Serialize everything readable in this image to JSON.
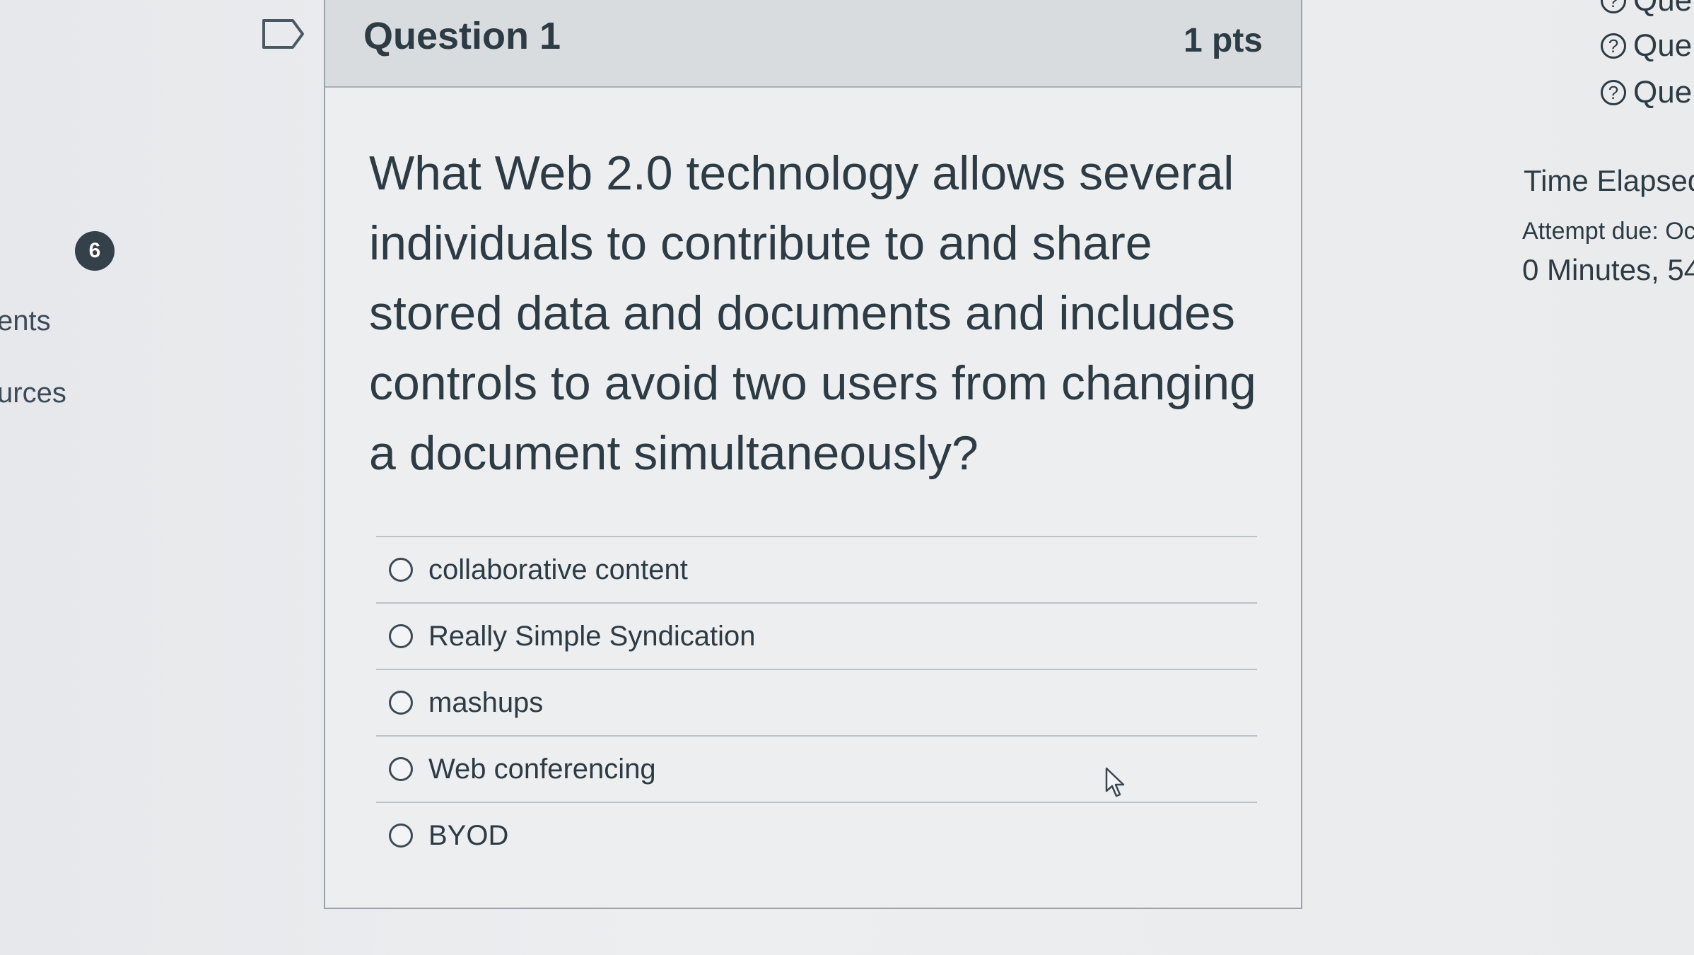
{
  "left_nav": {
    "badge_count": "6",
    "items": [
      {
        "label": "ents"
      },
      {
        "label": "urces"
      }
    ]
  },
  "question": {
    "title": "Question 1",
    "points": "1 pts",
    "text": "What Web 2.0 technology allows several individuals to contribute to and share stored data and documents and includes controls to avoid two users from changing a document simultaneously?",
    "answers": [
      {
        "label": "collaborative content"
      },
      {
        "label": "Really Simple Syndication"
      },
      {
        "label": "mashups"
      },
      {
        "label": "Web conferencing"
      },
      {
        "label": "BYOD"
      }
    ]
  },
  "sidebar": {
    "question_links": [
      {
        "label": "Que"
      },
      {
        "label": "Que"
      },
      {
        "label": "Que"
      }
    ],
    "time_elapsed_label": "Time Elapsed",
    "attempt_due": "Attempt due: Oc",
    "time_value": "0 Minutes, 54"
  },
  "icons": {
    "flag": "flag-icon",
    "question_status": "question-mark-icon",
    "cursor": "mouse-cursor-icon"
  }
}
